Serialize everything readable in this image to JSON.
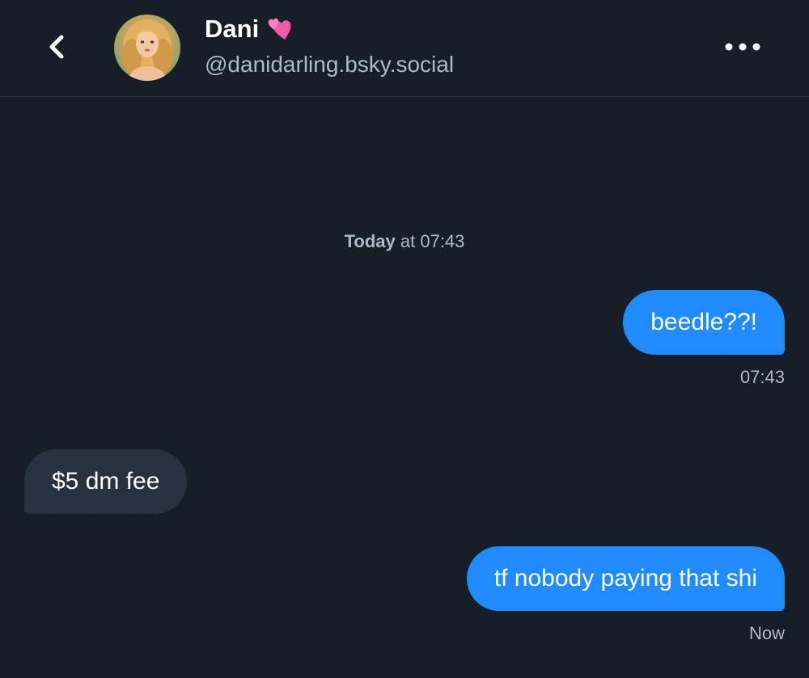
{
  "header": {
    "back_icon": "chevron-left-icon",
    "name": "Dani",
    "name_emoji": "💕",
    "handle": "@danidarling.bsky.social",
    "more_icon": "ellipsis-icon"
  },
  "divider": {
    "day": "Today",
    "at": "at",
    "time": "07:43"
  },
  "messages": [
    {
      "direction": "out",
      "text": "beedle??!",
      "time": "07:43"
    },
    {
      "direction": "in",
      "text": "$5 dm fee"
    },
    {
      "direction": "out",
      "text": "tf nobody paying that shi",
      "time": "Now"
    }
  ],
  "colors": {
    "background": "#161e27",
    "outgoing_bubble": "#208bfe",
    "incoming_bubble": "#263240",
    "secondary_text": "#aeb9c5"
  }
}
